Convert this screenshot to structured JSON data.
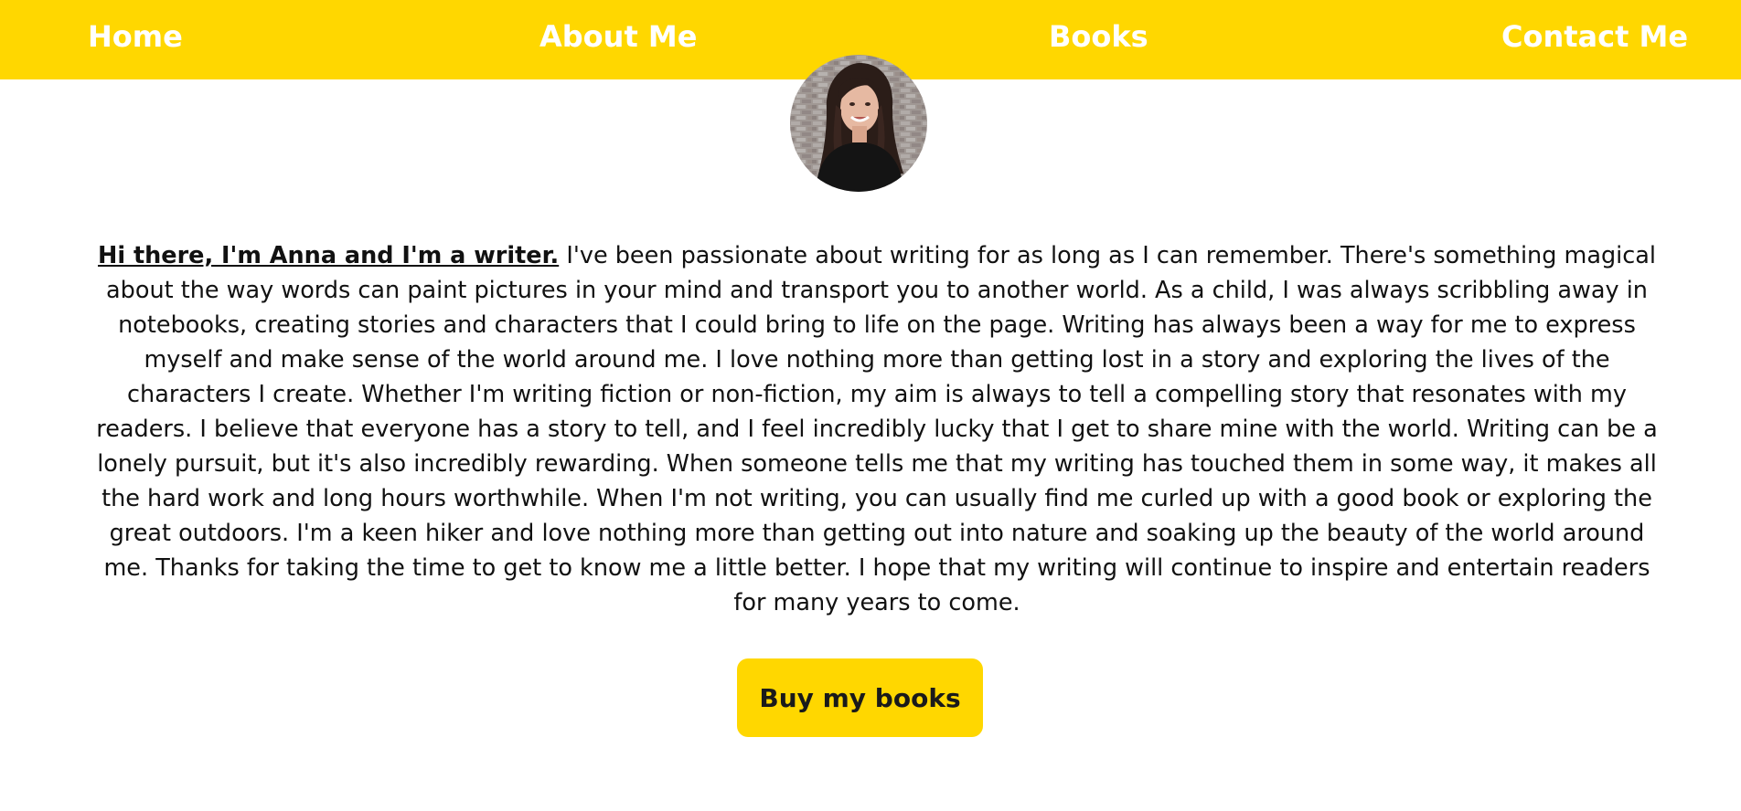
{
  "colors": {
    "accent": "#FFD700",
    "nav_text": "#ffffff",
    "body_text": "#111111",
    "background": "#ffffff"
  },
  "nav": {
    "items": [
      {
        "label": "Home"
      },
      {
        "label": "About Me"
      },
      {
        "label": "Books"
      },
      {
        "label": "Contact Me"
      }
    ]
  },
  "profile": {
    "avatar_icon": "profile-photo"
  },
  "bio": {
    "lead": "Hi there, I'm Anna and I'm a writer.",
    "text": " I've been passionate about writing for as long as I can remember. There's something magical about the way words can paint pictures in your mind and transport you to another world. As a child, I was always scribbling away in notebooks, creating stories and characters that I could bring to life on the page. Writing has always been a way for me to express myself and make sense of the world around me. I love nothing more than getting lost in a story and exploring the lives of the characters I create. Whether I'm writing fiction or non-fiction, my aim is always to tell a compelling story that resonates with my readers. I believe that everyone has a story to tell, and I feel incredibly lucky that I get to share mine with the world. Writing can be a lonely pursuit, but it's also incredibly rewarding. When someone tells me that my writing has touched them in some way, it makes all the hard work and long hours worthwhile. When I'm not writing, you can usually find me curled up with a good book or exploring the great outdoors. I'm a keen hiker and love nothing more than getting out into nature and soaking up the beauty of the world around me. Thanks for taking the time to get to know me a little better. I hope that my writing will continue to inspire and entertain readers for many years to come."
  },
  "cta": {
    "label": "Buy my books"
  }
}
